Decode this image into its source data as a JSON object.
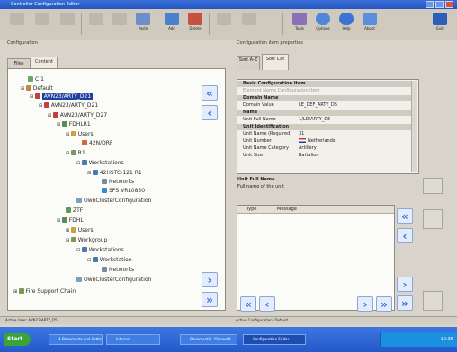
{
  "window": {
    "title": "Controller Configuration Editor"
  },
  "toolbar": {
    "buttons": [
      {
        "label": "",
        "icon": "new-icon",
        "enabled": false
      },
      {
        "label": "",
        "icon": "open-icon",
        "enabled": false
      },
      {
        "label": "",
        "icon": "save-icon",
        "enabled": false
      },
      {
        "label": "",
        "icon": "cut-icon",
        "enabled": false
      },
      {
        "label": "",
        "icon": "copy-icon",
        "enabled": false
      },
      {
        "label": "Paste",
        "icon": "paste-icon",
        "enabled": true
      },
      {
        "label": "Add",
        "icon": "add-icon",
        "enabled": true
      },
      {
        "label": "Delete",
        "icon": "delete-icon",
        "enabled": true
      },
      {
        "label": "",
        "icon": "undo-icon",
        "enabled": false
      },
      {
        "label": "",
        "icon": "redo-icon",
        "enabled": false
      },
      {
        "label": "Tools",
        "icon": "tools-icon",
        "enabled": true
      },
      {
        "label": "Options",
        "icon": "options-icon",
        "enabled": true
      },
      {
        "label": "Help",
        "icon": "help-icon",
        "enabled": true
      },
      {
        "label": "About",
        "icon": "about-icon",
        "enabled": true
      },
      {
        "label": "Exit",
        "icon": "exit-icon",
        "enabled": true
      }
    ]
  },
  "left_pane": {
    "title": "Configuration",
    "tabs": [
      "Files",
      "Content"
    ],
    "tree": [
      {
        "label": "C 1",
        "depth": 0
      },
      {
        "label": "Default",
        "depth": 0
      },
      {
        "label": "AVN23/ARTY_D21",
        "depth": 1,
        "selected": true
      },
      {
        "label": "AVN23/ARTY_D21",
        "depth": 2
      },
      {
        "label": "AVN23/ARTY_D27",
        "depth": 3
      },
      {
        "label": "FDHLR1",
        "depth": 3
      },
      {
        "label": "Users",
        "depth": 4
      },
      {
        "label": "42N/DRF",
        "depth": 5
      },
      {
        "label": "R1",
        "depth": 4
      },
      {
        "label": "Workstations",
        "depth": 5
      },
      {
        "label": "42HSTC-121 R1",
        "depth": 6
      },
      {
        "label": "Networks",
        "depth": 7
      },
      {
        "label": "SPS VRL0830",
        "depth": 7
      },
      {
        "label": "OwnClusterConfiguration",
        "depth": 5
      },
      {
        "label": "ZTF",
        "depth": 3
      },
      {
        "label": "FDHL",
        "depth": 3
      },
      {
        "label": "Users",
        "depth": 4
      },
      {
        "label": "Workgroup",
        "depth": 4
      },
      {
        "label": "Workstations",
        "depth": 5
      },
      {
        "label": "Workstation",
        "depth": 6
      },
      {
        "label": "Networks",
        "depth": 7
      },
      {
        "label": "OwnClusterConfiguration",
        "depth": 5
      },
      {
        "label": "Fire Support Chain",
        "depth": 0
      }
    ]
  },
  "right_pane": {
    "title": "Configuration item properties",
    "tabs": [
      "Sort A-Z",
      "Sort Cat"
    ],
    "properties": [
      {
        "key": "Basic Configuration Item",
        "value": "",
        "header": true
      },
      {
        "key": "Element Name Configuration Item",
        "value": "",
        "header": false
      },
      {
        "key": "Domain Name",
        "value": "",
        "header": true
      },
      {
        "key": "Domain Value",
        "value": "LE_DEF_ARTY_D5",
        "header": false
      },
      {
        "key": "Name",
        "value": "",
        "header": true
      },
      {
        "key": "Unit Full Name",
        "value": "1/LD/ARTY_D5",
        "header": false
      },
      {
        "key": "Unit Identification",
        "value": "",
        "header": true
      },
      {
        "key": "Unit Name (Required)",
        "value": "31",
        "header": false
      },
      {
        "key": "Unit Number",
        "value": "Netherlands",
        "header": false
      },
      {
        "key": "Unit Name Category",
        "value": "Artillery",
        "header": false
      },
      {
        "key": "Unit Size",
        "value": "Battalion",
        "header": false
      }
    ],
    "description_title": "Unit Full Name",
    "description_text": "Full name of the unit",
    "messages_columns": [
      "Type",
      "Message"
    ]
  },
  "statusbar": {
    "left": "Active User: AVN23/ARTY_D5",
    "right": "Active Configuration: Default"
  },
  "taskbar": {
    "start": "Start",
    "items": [
      {
        "label": "4 Documents and Settings",
        "active": false
      },
      {
        "label": "Internet",
        "active": false
      },
      {
        "label": "Document1 - Microsoft",
        "active": false
      },
      {
        "label": "Configuration Editor",
        "active": true
      }
    ],
    "clock": "10:35"
  },
  "colors": {
    "accent": "#2f6fe0",
    "selection": "#1f3f9e",
    "taskbar": "#2358c8"
  }
}
